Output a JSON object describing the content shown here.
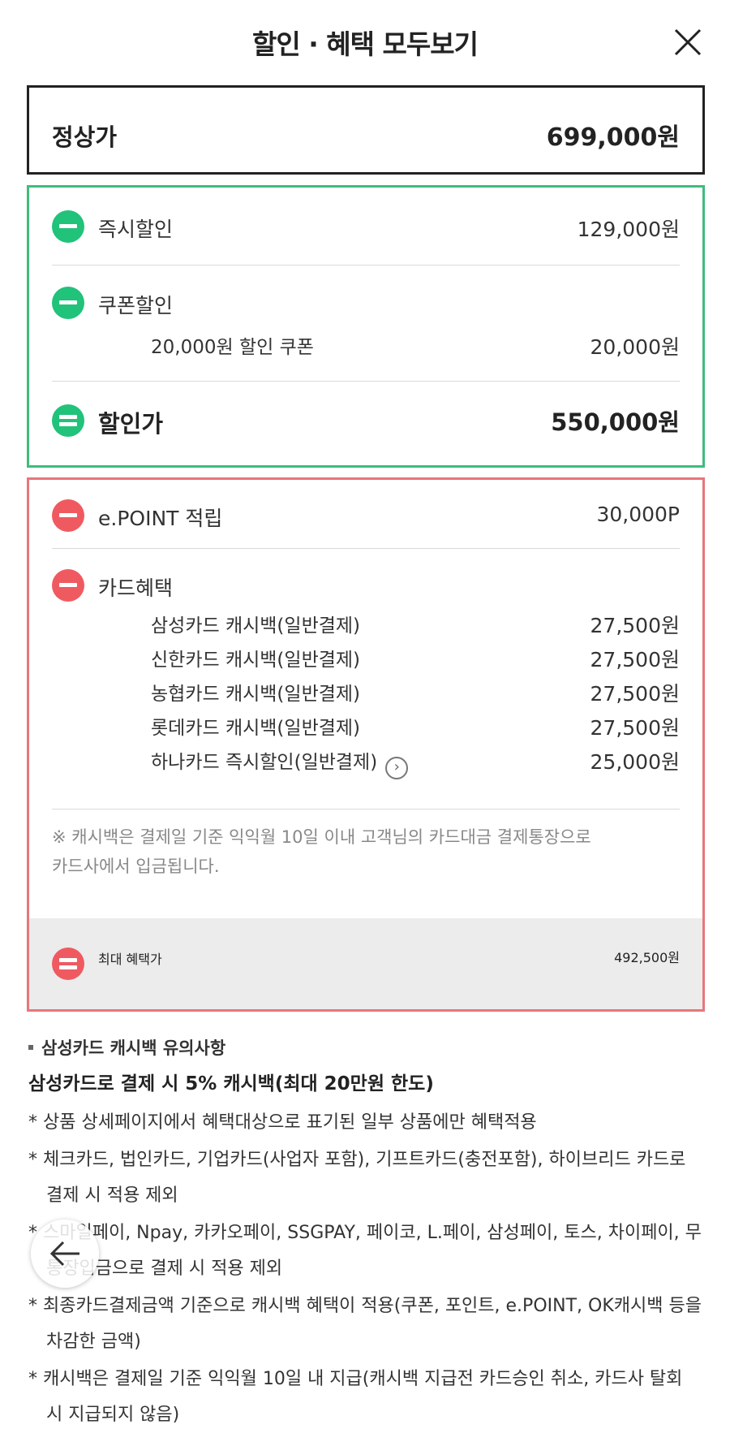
{
  "header": {
    "title": "할인 · 혜택 모두보기",
    "close_icon": "close-icon"
  },
  "regular": {
    "label": "정상가",
    "value": "699,000원"
  },
  "discounts": {
    "instant": {
      "label": "즉시할인",
      "value": "129,000원"
    },
    "coupon": {
      "label": "쿠폰할인",
      "sub_label": "20,000원 할인 쿠폰",
      "sub_value": "20,000원"
    },
    "total": {
      "label": "할인가",
      "value": "550,000원"
    }
  },
  "benefits": {
    "epoint": {
      "label": "e.POINT 적립",
      "value": "30,000P"
    },
    "card": {
      "label": "카드혜택",
      "items": [
        {
          "name": "삼성카드 캐시백(일반결제)",
          "value": "27,500원"
        },
        {
          "name": "신한카드 캐시백(일반결제)",
          "value": "27,500원"
        },
        {
          "name": "농협카드 캐시백(일반결제)",
          "value": "27,500원"
        },
        {
          "name": "롯데카드 캐시백(일반결제)",
          "value": "27,500원"
        },
        {
          "name": "하나카드 즉시할인(일반결제)",
          "value": "25,000원"
        }
      ]
    },
    "note_line1": "※ 캐시백은 결제일 기준 익익월 10일 이내 고객님의 카드대금 결제통장으로",
    "note_line2": "카드사에서 입금됩니다.",
    "final": {
      "label": "최대 혜택가",
      "value": "492,500원"
    }
  },
  "notes": {
    "heading": "삼성카드 캐시백 유의사항",
    "emphasis": "삼성카드로 결제 시 5% 캐시백(최대 20만원 한도)",
    "items": [
      "* 상품 상세페이지에서 혜택대상으로 표기된 일부 상품에만 혜택적용",
      "* 체크카드, 법인카드, 기업카드(사업자 포함), 기프트카드(충전포함), 하이브리드 카드로 결제 시 적용 제외",
      "* 스마일페이, Npay, 카카오페이, SSGPAY, 페이코, L.페이, 삼성페이, 토스, 차이페이, 무통장입금으로 결제 시 적용 제외",
      "* 최종카드결제금액 기준으로 캐시백 혜택이 적용(쿠폰, 포인트, e.POINT, OK캐시백 등을 차감한 금액)",
      "* 캐시백은 결제일 기준 익익월 10일 내 지급(캐시백 지급전 카드승인 취소, 카드사 탈회 시 지급되지 않음)"
    ]
  },
  "colors": {
    "green": "#21c27a",
    "red": "#ef5a60",
    "green_border": "#3dbd7d",
    "red_border": "#e8767a"
  },
  "icons": {
    "back": "arrow-left-icon",
    "chevron": "chevron-right-circle-icon"
  }
}
